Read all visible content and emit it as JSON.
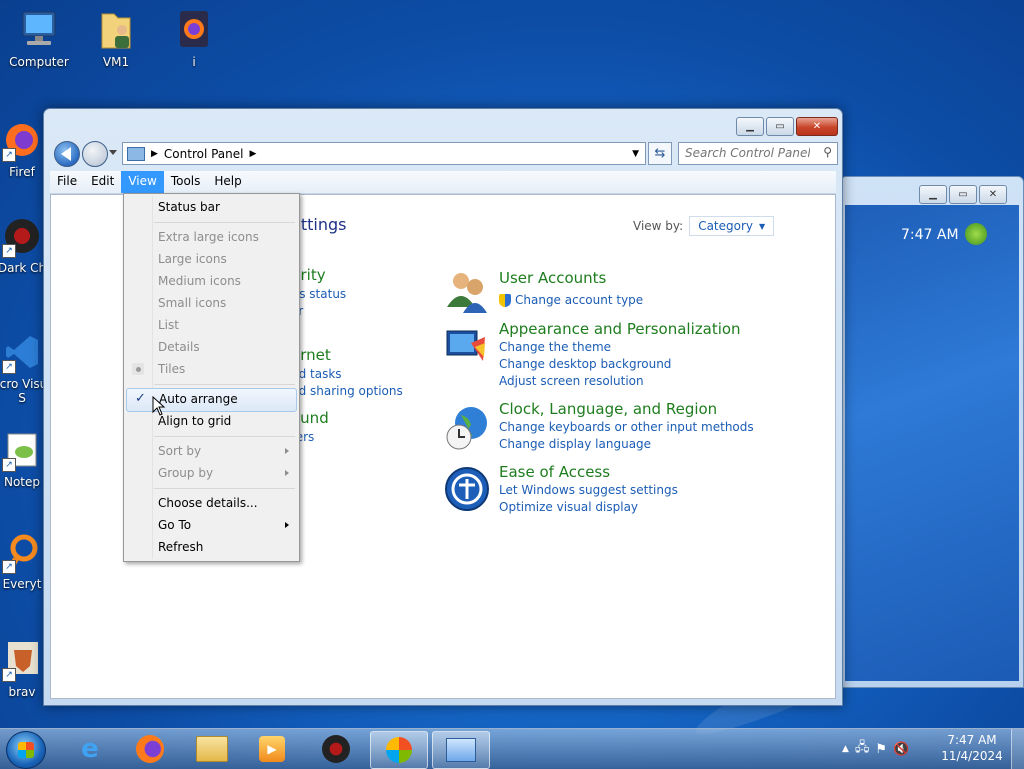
{
  "desktop": {
    "icons": [
      {
        "label": "Computer"
      },
      {
        "label": "VM1"
      },
      {
        "label": "i"
      },
      {
        "label": "Firef"
      },
      {
        "label": "Dark Ch"
      },
      {
        "label": "Micro Visual S"
      },
      {
        "label": "Notep"
      },
      {
        "label": "Everyt"
      },
      {
        "label": "brav"
      }
    ]
  },
  "background_window": {
    "clock_text": "7:47 AM"
  },
  "window": {
    "breadcrumb": "Control Panel",
    "search_placeholder": "Search Control Panel",
    "menu": [
      "File",
      "Edit",
      "View",
      "Tools",
      "Help"
    ],
    "heading_partial": "ettings",
    "view_by_label": "View by:",
    "view_by_value": "Category",
    "left_partial": {
      "security_title": "urity",
      "security_link1": "r's status",
      "security_link2": "er",
      "network_title": "ernet",
      "network_link1": "nd tasks",
      "network_link2": "nd sharing options",
      "sound_title": "ound",
      "sound_link1": "ters"
    },
    "categories": [
      {
        "title": "User Accounts",
        "links": [
          "Change account type"
        ]
      },
      {
        "title": "Appearance and Personalization",
        "links": [
          "Change the theme",
          "Change desktop background",
          "Adjust screen resolution"
        ]
      },
      {
        "title": "Clock, Language, and Region",
        "links": [
          "Change keyboards or other input methods",
          "Change display language"
        ]
      },
      {
        "title": "Ease of Access",
        "links": [
          "Let Windows suggest settings",
          "Optimize visual display"
        ]
      }
    ]
  },
  "view_menu": {
    "items": [
      {
        "label": "Status bar",
        "enabled": true
      },
      {
        "label": "Extra large icons",
        "enabled": false
      },
      {
        "label": "Large icons",
        "enabled": false
      },
      {
        "label": "Medium icons",
        "enabled": false
      },
      {
        "label": "Small icons",
        "enabled": false
      },
      {
        "label": "List",
        "enabled": false
      },
      {
        "label": "Details",
        "enabled": false
      },
      {
        "label": "Tiles",
        "enabled": false,
        "radio": true
      },
      {
        "label": "Auto arrange",
        "enabled": true,
        "checked": true,
        "hover": true
      },
      {
        "label": "Align to grid",
        "enabled": true
      },
      {
        "label": "Sort by",
        "enabled": false,
        "submenu": true
      },
      {
        "label": "Group by",
        "enabled": false,
        "submenu": true
      },
      {
        "label": "Choose details...",
        "enabled": true
      },
      {
        "label": "Go To",
        "enabled": true,
        "submenu": true
      },
      {
        "label": "Refresh",
        "enabled": true
      }
    ]
  },
  "taskbar": {
    "clock_time": "7:47 AM",
    "clock_date": "11/4/2024"
  },
  "colors": {
    "link": "#1c5db5",
    "category_title": "#1e7d1e",
    "menu_highlight": "#3399ff"
  }
}
